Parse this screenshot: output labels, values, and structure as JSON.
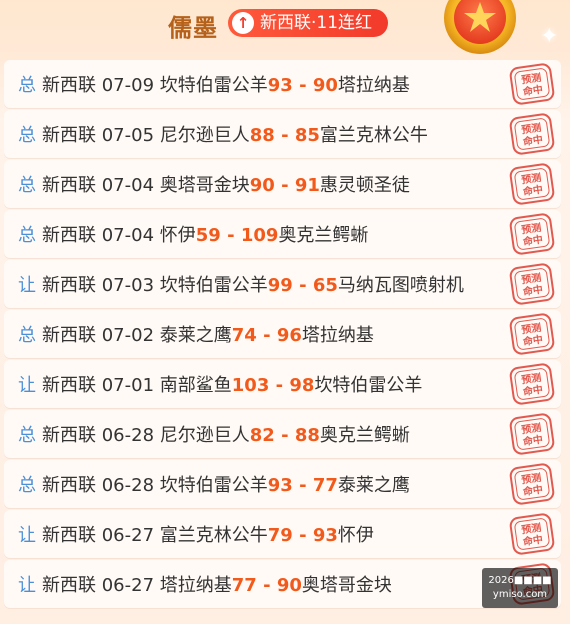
{
  "header": {
    "author": "儒墨",
    "streak_label": "新西联·11连红",
    "streak_icon": "up-arrow-icon",
    "medal_icon": "trophy-medal-icon"
  },
  "colors": {
    "score": "#f25a1b",
    "kind": "#4a90d9",
    "stamp": "#e25a4f",
    "badge": "#f23a2a"
  },
  "records": [
    {
      "kind": "总",
      "league": "新西联",
      "date": "07-09",
      "home": "坎特伯雷公羊",
      "home_score": "93",
      "sep": " - ",
      "away_score": "90",
      "away": "塔拉纳基",
      "stamp": "预测命中"
    },
    {
      "kind": "总",
      "league": "新西联",
      "date": "07-05",
      "home": "尼尔逊巨人",
      "home_score": "88",
      "sep": " - ",
      "away_score": "85",
      "away": "富兰克林公牛",
      "stamp": "预测命中"
    },
    {
      "kind": "总",
      "league": "新西联",
      "date": "07-04",
      "home": "奥塔哥金块",
      "home_score": "90",
      "sep": " - ",
      "away_score": "91",
      "away": "惠灵顿圣徒",
      "stamp": "预测命中"
    },
    {
      "kind": "总",
      "league": "新西联",
      "date": "07-04",
      "home": "怀伊",
      "home_score": "59",
      "sep": " - ",
      "away_score": "109",
      "away": "奥克兰鳄蜥",
      "stamp": "预测命中"
    },
    {
      "kind": "让",
      "league": "新西联",
      "date": "07-03",
      "home": "坎特伯雷公羊",
      "home_score": "99",
      "sep": " - ",
      "away_score": "65",
      "away": "马纳瓦图喷射机",
      "stamp": "预测命中"
    },
    {
      "kind": "总",
      "league": "新西联",
      "date": "07-02",
      "home": "泰莱之鹰",
      "home_score": "74",
      "sep": " - ",
      "away_score": "96",
      "away": "塔拉纳基",
      "stamp": "预测命中"
    },
    {
      "kind": "让",
      "league": "新西联",
      "date": "07-01",
      "home": "南部鲨鱼",
      "home_score": "103",
      "sep": " - ",
      "away_score": "98",
      "away": "坎特伯雷公羊",
      "stamp": "预测命中"
    },
    {
      "kind": "总",
      "league": "新西联",
      "date": "06-28",
      "home": "尼尔逊巨人",
      "home_score": "82",
      "sep": " - ",
      "away_score": "88",
      "away": "奥克兰鳄蜥",
      "stamp": "预测命中"
    },
    {
      "kind": "总",
      "league": "新西联",
      "date": "06-28",
      "home": "坎特伯雷公羊",
      "home_score": "93",
      "sep": " - ",
      "away_score": "77",
      "away": "泰莱之鹰",
      "stamp": "预测命中"
    },
    {
      "kind": "让",
      "league": "新西联",
      "date": "06-27",
      "home": "富兰克林公牛",
      "home_score": "79",
      "sep": " - ",
      "away_score": "93",
      "away": "怀伊",
      "stamp": "预测命中"
    },
    {
      "kind": "让",
      "league": "新西联",
      "date": "06-27",
      "home": "塔拉纳基",
      "home_score": "77",
      "sep": " - ",
      "away_score": "90",
      "away": "奥塔哥金块",
      "stamp": "预测命中"
    }
  ],
  "watermark": {
    "line1": "2026■■■■",
    "line2": "ymiso.com"
  }
}
